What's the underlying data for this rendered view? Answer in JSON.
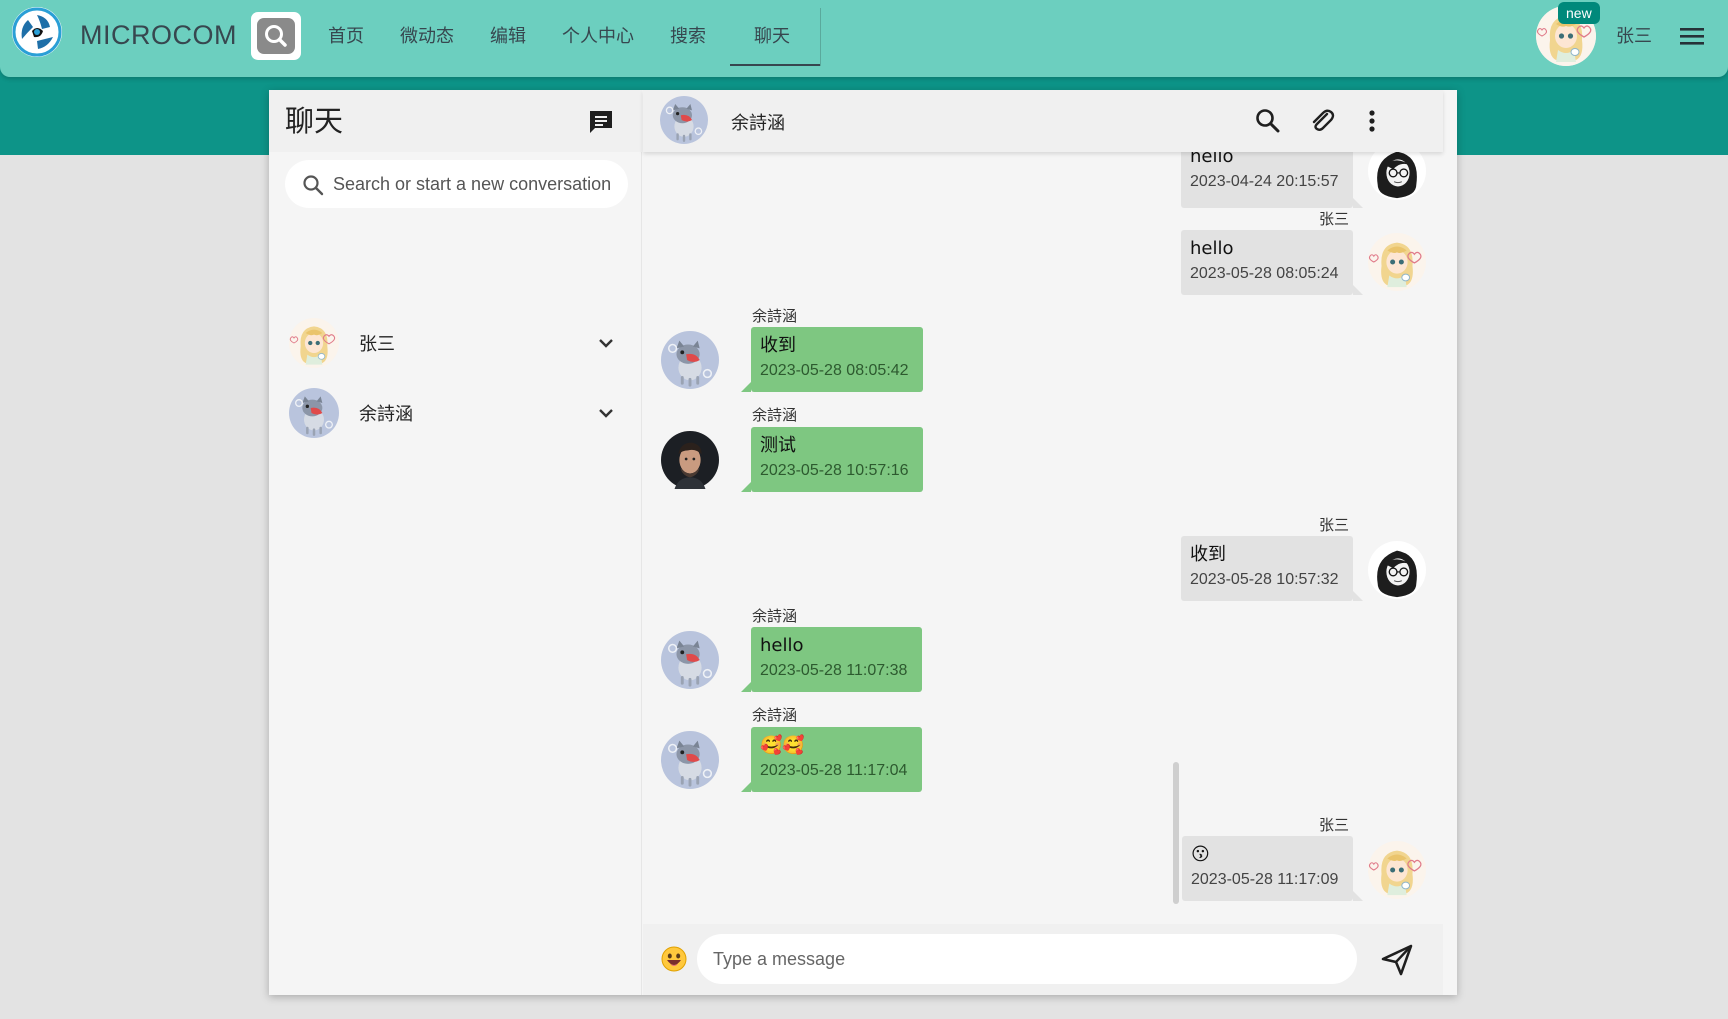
{
  "app": {
    "brand": "MICROCOM",
    "new_badge": "new"
  },
  "nav": {
    "items": [
      {
        "label": "首页"
      },
      {
        "label": "微动态"
      },
      {
        "label": "编辑"
      },
      {
        "label": "个人中心"
      },
      {
        "label": "搜索"
      },
      {
        "label": "聊天",
        "active": true
      }
    ]
  },
  "user": {
    "name": "张三"
  },
  "sidebar": {
    "title": "聊天",
    "search_placeholder": "Search or start a new conversation",
    "contacts": [
      {
        "name": "张三",
        "avatar": "anime-girl-avatar"
      },
      {
        "name": "余詩涵",
        "avatar": "cartoon-cat-avatar"
      }
    ]
  },
  "chat": {
    "title": "余詩涵",
    "messages": [
      {
        "dir": "out",
        "sender": "",
        "text": "hello",
        "time": "2023-04-24 20:15:57",
        "avatar": "glasses-woman-avatar"
      },
      {
        "dir": "out",
        "sender": "张三",
        "text": "hello",
        "time": "2023-05-28 08:05:24",
        "avatar": "anime-girl-avatar"
      },
      {
        "dir": "in",
        "sender": "余詩涵",
        "text": "收到",
        "time": "2023-05-28 08:05:42",
        "avatar": "cartoon-cat-avatar"
      },
      {
        "dir": "in",
        "sender": "余詩涵",
        "text": "测试",
        "time": "2023-05-28 10:57:16",
        "avatar": "man-photo-avatar"
      },
      {
        "dir": "out",
        "sender": "张三",
        "text": "收到",
        "time": "2023-05-28 10:57:32",
        "avatar": "glasses-woman-avatar"
      },
      {
        "dir": "in",
        "sender": "余詩涵",
        "text": "hello",
        "time": "2023-05-28 11:07:38",
        "avatar": "cartoon-cat-avatar"
      },
      {
        "dir": "in",
        "sender": "余詩涵",
        "text": "🥰🥰",
        "time": "2023-05-28 11:17:04",
        "avatar": "cartoon-cat-avatar"
      },
      {
        "dir": "out",
        "sender": "张三",
        "text": "😗",
        "time": "2023-05-28 11:17:09",
        "avatar": "anime-girl-avatar"
      }
    ],
    "composer_placeholder": "Type a message"
  },
  "colors": {
    "header": "#6ccfbf",
    "band": "#0d9488",
    "incoming_bubble": "#7ec781",
    "outgoing_bubble": "#e2e2e2"
  }
}
